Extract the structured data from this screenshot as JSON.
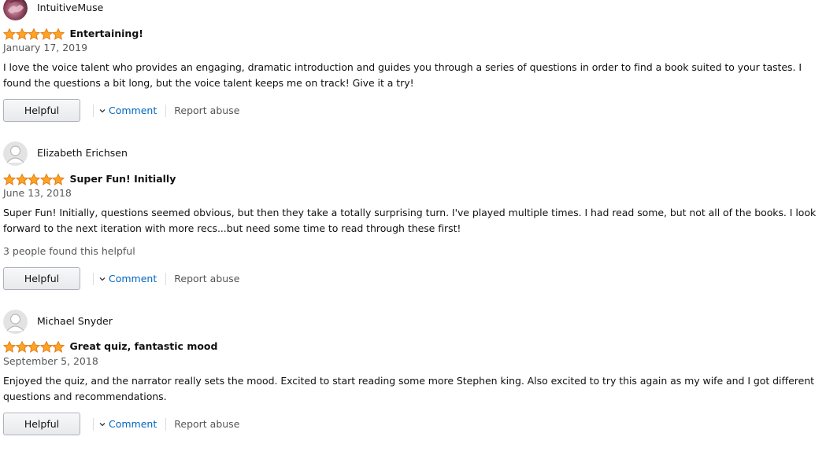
{
  "reviews": [
    {
      "username": "IntuitiveMuse",
      "avatar": "profile-photo",
      "rating": 5,
      "title": "Entertaining!",
      "date": "January 17, 2019",
      "body": "I love the voice talent who provides an engaging, dramatic introduction and guides you through a series of questions in order to find a book suited to your tastes. I found the questions a bit long, but the voice talent keeps me on track! Give it a try!",
      "helpful_count": "",
      "helpful_label": "Helpful",
      "comment_label": "Comment",
      "report_label": "Report abuse"
    },
    {
      "username": "Elizabeth Erichsen",
      "avatar": "default-avatar",
      "rating": 5,
      "title": "Super Fun! Initially",
      "date": "June 13, 2018",
      "body": "Super Fun! Initially, questions seemed obvious, but then they take a totally surprising turn. I've played multiple times. I had read some, but not all of the books. I look forward to the next iteration with more recs...but need some time to read through these first!",
      "helpful_count": "3 people found this helpful",
      "helpful_label": "Helpful",
      "comment_label": "Comment",
      "report_label": "Report abuse"
    },
    {
      "username": "Michael Snyder",
      "avatar": "default-avatar",
      "rating": 5,
      "title": "Great quiz, fantastic mood",
      "date": "September 5, 2018",
      "body": "Enjoyed the quiz, and the narrator really sets the mood. Excited to start reading some more Stephen king. Also excited to try this again as my wife and I got different questions and recommendations.",
      "helpful_count": "",
      "helpful_label": "Helpful",
      "comment_label": "Comment",
      "report_label": "Report abuse"
    }
  ],
  "colors": {
    "star_fill": "#ffa41c",
    "star_stroke": "#de7921",
    "link": "#0066c0",
    "muted_text": "#565959"
  }
}
